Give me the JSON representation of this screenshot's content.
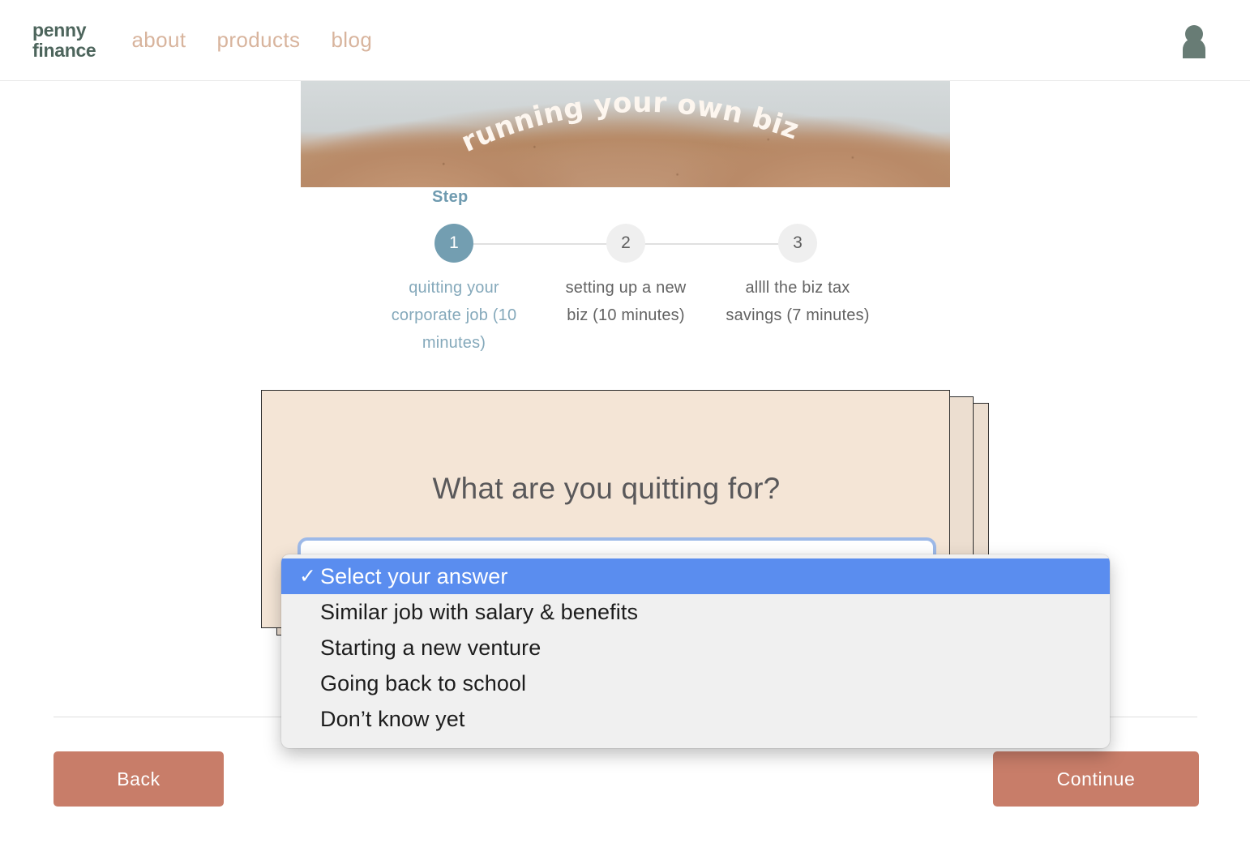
{
  "header": {
    "logo_text": "penny\nfinance",
    "logo_color": "#4d655c",
    "nav": [
      {
        "label": "about"
      },
      {
        "label": "products"
      },
      {
        "label": "blog"
      }
    ],
    "nav_color": "#d8b49d",
    "avatar_icon": "user-avatar-icon",
    "avatar_color": "#687c75"
  },
  "hero": {
    "arc_text": "running your own biz",
    "text_color": "#fdf6ef"
  },
  "stepper": {
    "label": "Step",
    "label_color": "#6f9bb0",
    "active_circle_color": "#739eb1",
    "inactive_circle_color": "#efefef",
    "steps": [
      {
        "number": "1",
        "caption": "quitting your corporate job (10 minutes)",
        "active": true
      },
      {
        "number": "2",
        "caption": "setting up a new biz (10 minutes)",
        "active": false
      },
      {
        "number": "3",
        "caption": "allll the biz tax savings (7 minutes)",
        "active": false
      }
    ]
  },
  "card": {
    "question": "What are you quitting for?",
    "background_color": "#f4e5d6",
    "border_color": "#2c2c2c",
    "select_value": "",
    "select_placeholder": "Select your answer",
    "focus_ring_color": "#8db2eb"
  },
  "dropdown": {
    "open": true,
    "highlight_color": "#5a8def",
    "check_glyph": "✓",
    "options": [
      {
        "label": "Select your answer",
        "selected": true
      },
      {
        "label": "Similar job with salary & benefits",
        "selected": false
      },
      {
        "label": "Starting a new venture",
        "selected": false
      },
      {
        "label": "Going back to school",
        "selected": false
      },
      {
        "label": "Don’t know yet",
        "selected": false
      }
    ]
  },
  "footer": {
    "back_label": "Back",
    "continue_label": "Continue",
    "button_color": "#c87d69"
  }
}
